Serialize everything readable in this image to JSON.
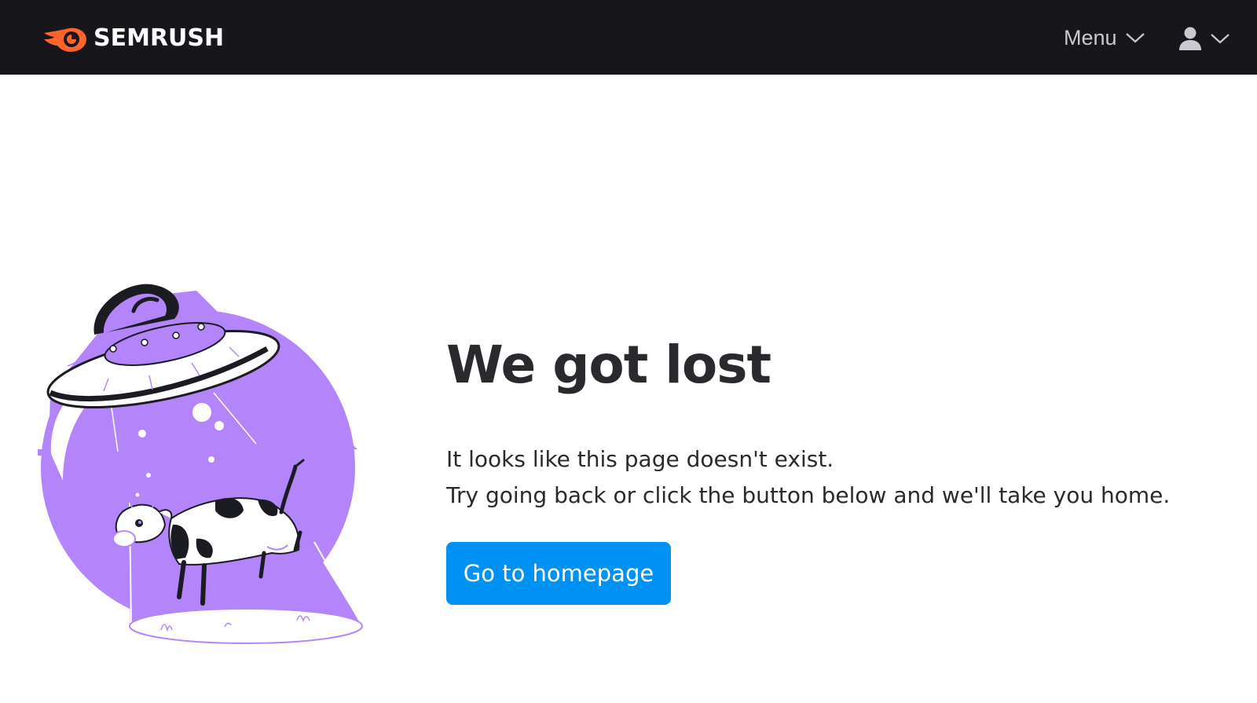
{
  "header": {
    "brand": "SEMRUSH",
    "menu_label": "Menu",
    "icons": {
      "logo": "semrush-fire-logo",
      "menu_chevron": "chevron-down-icon",
      "user": "user-icon",
      "user_chevron": "chevron-down-icon"
    }
  },
  "main": {
    "title": "We got lost",
    "line1": "It looks like this page doesn't exist.",
    "line2": "Try going back or click the button below and we'll take you home.",
    "button_label": "Go to homepage"
  },
  "colors": {
    "topbar": "#16161b",
    "brand_orange": "#ff642d",
    "accent_purple": "#b484fa",
    "button_blue": "#0092f2",
    "text_dark": "#2a2a2e"
  }
}
